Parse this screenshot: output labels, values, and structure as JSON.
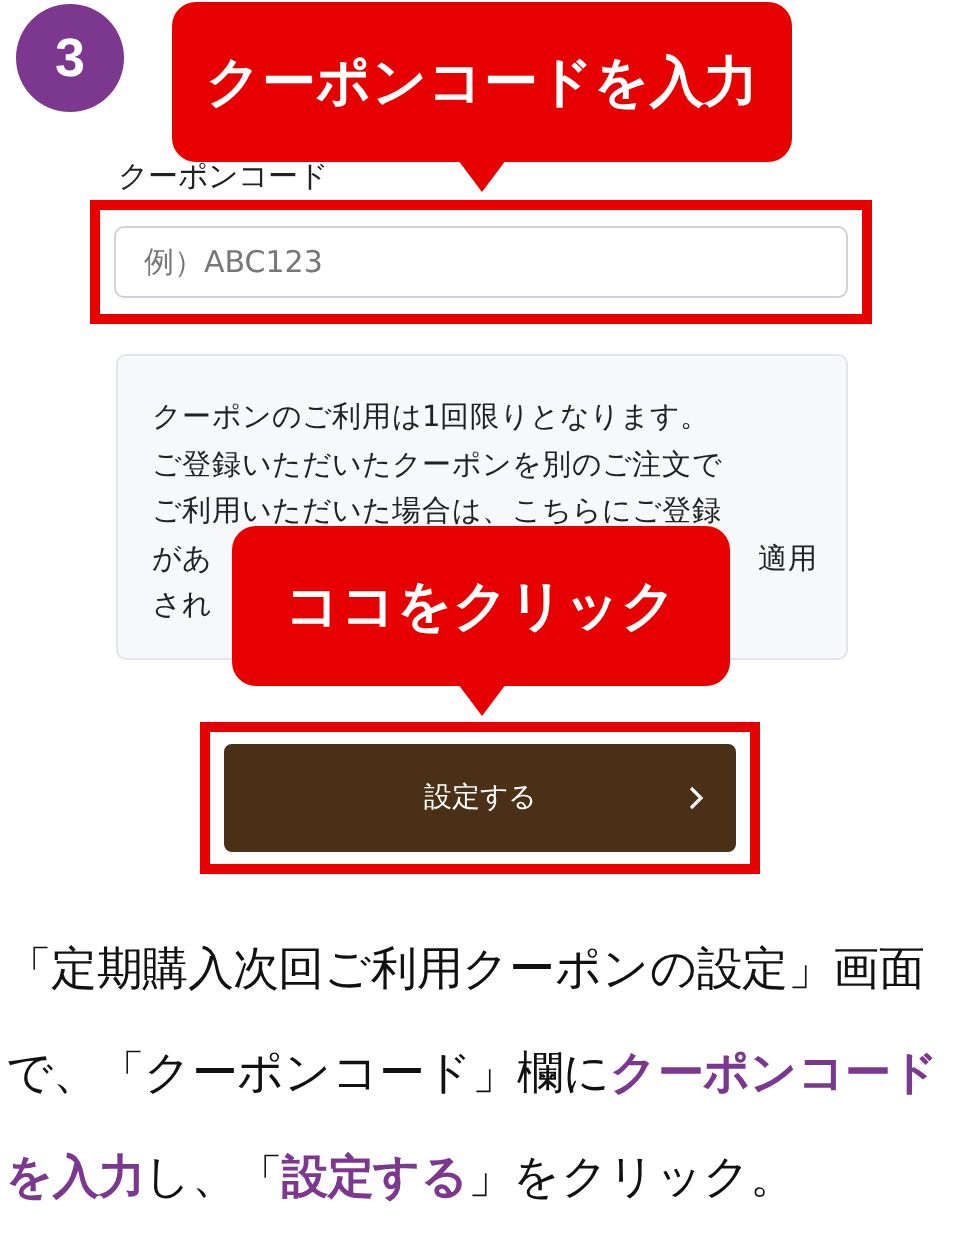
{
  "step_badge": "3",
  "coupon_field": {
    "label": "クーポンコード",
    "placeholder": "例）ABC123"
  },
  "notice": {
    "lines": [
      [
        "クーポンのご利用は1回限りとなります。"
      ],
      [
        "ご登録いただいたクーポンを別のご注文で"
      ],
      [
        "ご利用いただいた場合は、こちらにご登録"
      ],
      [
        "があ",
        "適用"
      ],
      [
        "され"
      ]
    ]
  },
  "submit_button": {
    "label": "設定する"
  },
  "callouts": [
    {
      "text": "クーポンコードを入力"
    },
    {
      "text": "ココをクリック"
    }
  ],
  "caption": "「定期購入次回ご利用クーポンの設定」画面で、「クーポンコード」欄に**クーポンコードを入力**し、「**設定する**」をクリック。"
}
